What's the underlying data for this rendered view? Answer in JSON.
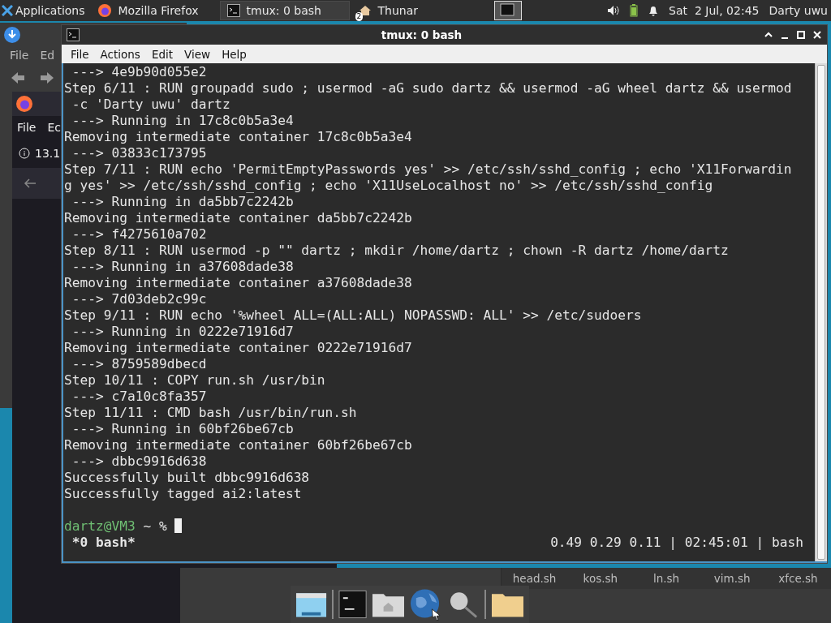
{
  "panel": {
    "apps_menu": "Applications",
    "tasks": [
      {
        "label": "Mozilla Firefox",
        "kind": "browser",
        "selected": false
      },
      {
        "label": "tmux: 0 bash",
        "kind": "terminal",
        "selected": true
      },
      {
        "label": "Thunar",
        "kind": "files",
        "badge": "2",
        "selected": false
      }
    ],
    "clock": "Sat  2 Jul, 02:45",
    "user": "Darty uwu"
  },
  "file_manager_back": {
    "menu": [
      "File",
      "Ed"
    ]
  },
  "browser": {
    "menu": [
      "File",
      "Ec"
    ],
    "address": "13.1"
  },
  "terminal": {
    "title": "tmux: 0 bash",
    "menu": [
      "File",
      "Actions",
      "Edit",
      "View",
      "Help"
    ],
    "lines": [
      " ---> 4e9b90d055e2",
      "Step 6/11 : RUN groupadd sudo ; usermod -aG sudo dartz && usermod -aG wheel dartz && usermod",
      " -c 'Darty uwu' dartz",
      " ---> Running in 17c8c0b5a3e4",
      "Removing intermediate container 17c8c0b5a3e4",
      " ---> 03833c173795",
      "Step 7/11 : RUN echo 'PermitEmptyPasswords yes' >> /etc/ssh/sshd_config ; echo 'X11Forwardin",
      "g yes' >> /etc/ssh/sshd_config ; echo 'X11UseLocalhost no' >> /etc/ssh/sshd_config",
      " ---> Running in da5bb7c2242b",
      "Removing intermediate container da5bb7c2242b",
      " ---> f4275610a702",
      "Step 8/11 : RUN usermod -p \"\" dartz ; mkdir /home/dartz ; chown -R dartz /home/dartz",
      " ---> Running in a37608dade38",
      "Removing intermediate container a37608dade38",
      " ---> 7d03deb2c99c",
      "Step 9/11 : RUN echo '%wheel ALL=(ALL:ALL) NOPASSWD: ALL' >> /etc/sudoers",
      " ---> Running in 0222e71916d7",
      "Removing intermediate container 0222e71916d7",
      " ---> 8759589dbecd",
      "Step 10/11 : COPY run.sh /usr/bin",
      " ---> c7a10c8fa357",
      "Step 11/11 : CMD bash /usr/bin/run.sh",
      " ---> Running in 60bf26be67cb",
      "Removing intermediate container 60bf26be67cb",
      " ---> dbbc9916d638",
      "Successfully built dbbc9916d638",
      "Successfully tagged ai2:latest"
    ],
    "prompt": {
      "user_host": "dartz@VM3",
      "rest": " ~ % "
    },
    "status_left": "*0 bash*",
    "status_right": "0.49 0.29 0.11 | 02:45:01 | bash"
  },
  "file_manager_front": {
    "files": [
      "head.sh",
      "kos.sh",
      "ln.sh",
      "vim.sh",
      "xfce.sh"
    ]
  }
}
